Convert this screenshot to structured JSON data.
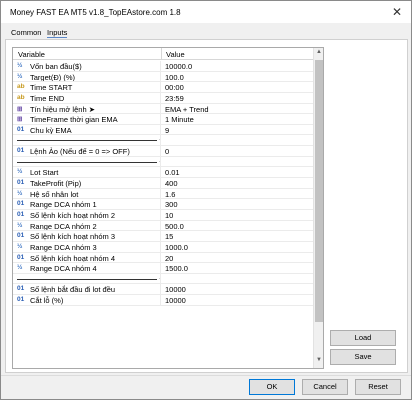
{
  "window": {
    "title": "Money FAST EA MT5 v1.8_TopEAstore.com 1.8",
    "close_glyph": "✕"
  },
  "tabs": [
    {
      "label": "Common"
    },
    {
      "label": "Inputs"
    }
  ],
  "grid": {
    "headers": {
      "variable": "Variable",
      "value": "Value"
    },
    "rows": [
      {
        "icon": "½",
        "label": "Vốn ban đầu($)",
        "value": "10000.0"
      },
      {
        "icon": "½",
        "label": "Target(Đ) (%)",
        "value": "100.0"
      },
      {
        "icon": "ab",
        "label": "Time START",
        "value": "00:00"
      },
      {
        "icon": "ab",
        "label": "Time END",
        "value": "23:59"
      },
      {
        "icon": "⊞",
        "label": "Tín hiệu mở lệnh ➤",
        "value": "EMA + Trend"
      },
      {
        "icon": "⊞",
        "label": "TimeFrame thời gian EMA",
        "value": "1 Minute"
      },
      {
        "icon": "01",
        "label": "Chu kỳ EMA",
        "value": "9"
      },
      {
        "sep": true,
        "dots": "..."
      },
      {
        "icon": "01",
        "label": "Lệnh Ảo (Nếu để = 0 => OFF)",
        "value": "0"
      },
      {
        "sep": true,
        "dots": "..."
      },
      {
        "icon": "½",
        "label": "Lot Start",
        "value": "0.01"
      },
      {
        "icon": "01",
        "label": "TakeProfit (Pip)",
        "value": "400"
      },
      {
        "icon": "½",
        "label": "Hệ số nhân lot",
        "value": "1.6"
      },
      {
        "icon": "01",
        "label": "Range DCA nhóm 1",
        "value": "300"
      },
      {
        "icon": "01",
        "label": "Số lệnh kích hoạt nhóm 2",
        "value": "10"
      },
      {
        "icon": "½",
        "label": "Range DCA nhóm 2",
        "value": "500.0"
      },
      {
        "icon": "01",
        "label": "Số lệnh kích hoạt nhóm 3",
        "value": "15"
      },
      {
        "icon": "½",
        "label": "Range DCA nhóm 3",
        "value": "1000.0"
      },
      {
        "icon": "01",
        "label": "Số lệnh kích hoạt nhóm 4",
        "value": "20"
      },
      {
        "icon": "½",
        "label": "Range DCA nhóm 4",
        "value": "1500.0"
      },
      {
        "sep": true,
        "dots": "..."
      },
      {
        "icon": "01",
        "label": "Số lệnh bắt đầu đi lot đều",
        "value": "10000"
      },
      {
        "icon": "01",
        "label": "Cắt lỗ (%)",
        "value": "10000"
      }
    ]
  },
  "side_buttons": {
    "load": "Load",
    "save": "Save"
  },
  "footer_buttons": {
    "ok": "OK",
    "cancel": "Cancel",
    "reset": "Reset"
  },
  "colors": {
    "accent": "#0078d7",
    "tab_underline": "#5b87c7"
  }
}
